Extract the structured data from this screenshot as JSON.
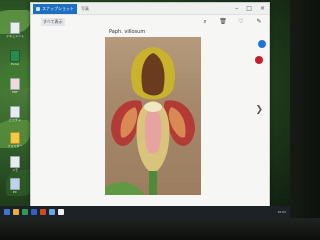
{
  "window": {
    "app_tab_label": "スナップショット",
    "title": "写真",
    "controls": {
      "minimize": "–",
      "maximize": "□",
      "close": "×"
    }
  },
  "toolbar": {
    "view_label": "すべて表示",
    "tools": [
      "⌕",
      "🗑",
      "♡",
      "✎"
    ]
  },
  "photo": {
    "caption": "Paph. villosum",
    "subject": "Paphiopedilum villosum orchid"
  },
  "nav": {
    "next": "❯"
  },
  "desktop": {
    "icons": [
      {
        "label": "ドキュメント"
      },
      {
        "label": "Excel"
      },
      {
        "label": "PDF"
      },
      {
        "label": "ピクチャ"
      },
      {
        "label": "フォルダー"
      },
      {
        "label": "メモ"
      },
      {
        "label": "PC"
      }
    ]
  },
  "taskbar": {
    "clock": "10:52"
  },
  "colors": {
    "accent": "#1e6fbf",
    "blue_dot": "#1e74d8",
    "red_dot": "#c81d2b"
  }
}
